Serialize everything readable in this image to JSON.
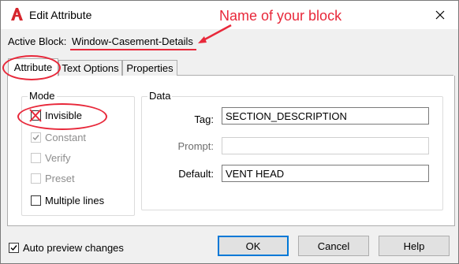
{
  "window": {
    "title": "Edit Attribute"
  },
  "annotation": {
    "text": "Name of your block"
  },
  "active_block": {
    "label": "Active Block:",
    "value": "Window-Casement-Details"
  },
  "tabs": [
    {
      "label": "Attribute",
      "selected": true
    },
    {
      "label": "Text Options",
      "selected": false
    },
    {
      "label": "Properties",
      "selected": false
    }
  ],
  "mode": {
    "title": "Mode",
    "options": [
      {
        "label": "Invisible",
        "checked": false,
        "enabled": true,
        "annotated_mark": "X"
      },
      {
        "label": "Constant",
        "checked": true,
        "enabled": false
      },
      {
        "label": "Verify",
        "checked": false,
        "enabled": false
      },
      {
        "label": "Preset",
        "checked": false,
        "enabled": false
      },
      {
        "label": "Multiple lines",
        "checked": false,
        "enabled": true
      }
    ]
  },
  "data": {
    "title": "Data",
    "tag": {
      "label": "Tag:",
      "value": "SECTION_DESCRIPTION"
    },
    "prompt": {
      "label": "Prompt:",
      "value": ""
    },
    "default": {
      "label": "Default:",
      "value": "VENT HEAD"
    }
  },
  "auto_preview": {
    "label": "Auto preview changes",
    "checked": true
  },
  "buttons": {
    "ok": "OK",
    "cancel": "Cancel",
    "help": "Help"
  },
  "colors": {
    "annotation": "#e8283a",
    "accent": "#0078d7"
  },
  "icons": {
    "app": "autocad-logo-icon",
    "close": "close-icon",
    "arrow": "annotation-arrow-icon"
  }
}
